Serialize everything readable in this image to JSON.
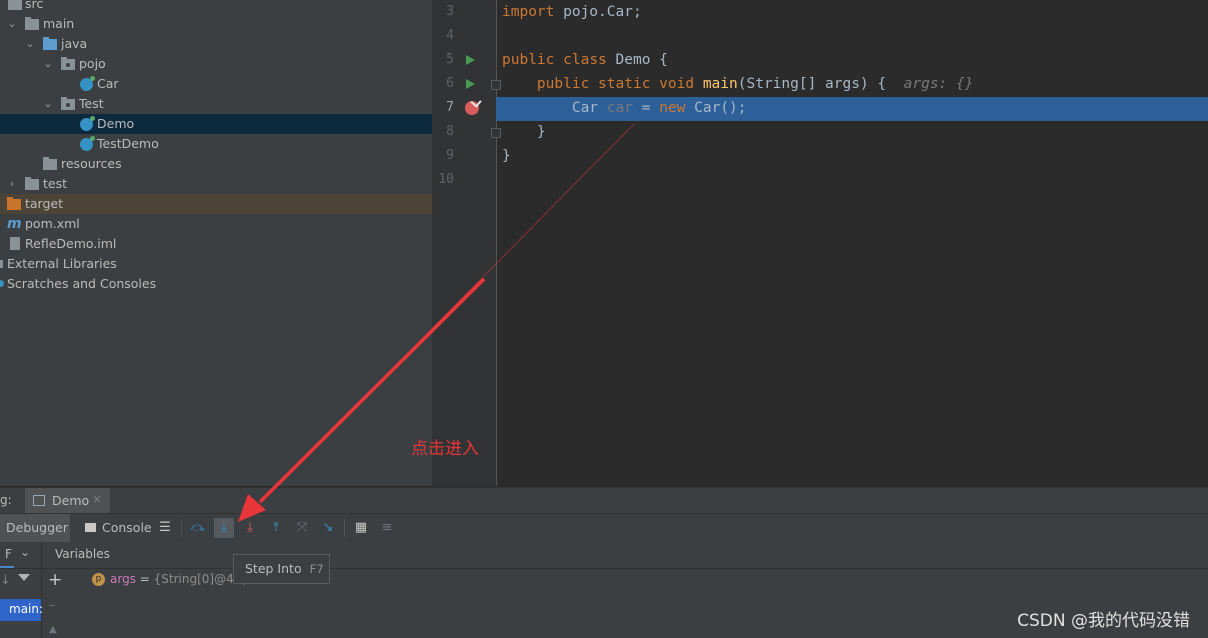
{
  "project_tree": {
    "items": [
      {
        "label": "src"
      },
      {
        "label": "main"
      },
      {
        "label": "java"
      },
      {
        "label": "pojo"
      },
      {
        "label": "Car"
      },
      {
        "label": "Test"
      },
      {
        "label": "Demo"
      },
      {
        "label": "TestDemo"
      },
      {
        "label": "resources"
      },
      {
        "label": "test"
      },
      {
        "label": "target"
      },
      {
        "label": "pom.xml"
      },
      {
        "label": "RefleDemo.iml"
      },
      {
        "label": "External Libraries"
      },
      {
        "label": "Scratches and Consoles"
      }
    ]
  },
  "editor": {
    "line_numbers": [
      "3",
      "4",
      "5",
      "6",
      "7",
      "8",
      "9",
      "10"
    ],
    "lines": {
      "l3": {
        "kw": "import",
        "rest": " pojo.Car;"
      },
      "l5": {
        "kw1": "public",
        "kw2": "class",
        "rest": " Demo {"
      },
      "l6": {
        "kw1": "public",
        "kw2": "static",
        "kw3": "void",
        "fn": "main",
        "rest": "(String[] args) {",
        "hint": "args: {}"
      },
      "l7": {
        "type": "Car",
        "var": "car",
        "eq": " = ",
        "kw": "new",
        "rest": " Car();"
      },
      "l8": {
        "text": "}"
      },
      "l9": {
        "text": "}"
      }
    }
  },
  "annotation": {
    "text": "点击进入"
  },
  "debug": {
    "header_prefix": "g:",
    "session_tab": "Demo",
    "tabs": {
      "debugger": "Debugger",
      "console": "Console"
    },
    "frames_label": "F",
    "variables_label": "Variables",
    "variable": {
      "name": "args",
      "eq": " = ",
      "value": "{String[0]@48("
    },
    "frame_selected": "main:",
    "tooltip": {
      "label": "Step Into",
      "key": "F7"
    }
  },
  "watermark": "CSDN @我的代码没错",
  "colors": {
    "execution_line": "#2d6099",
    "annotation_red": "#e8353a",
    "selected_row": "#0d293e"
  }
}
